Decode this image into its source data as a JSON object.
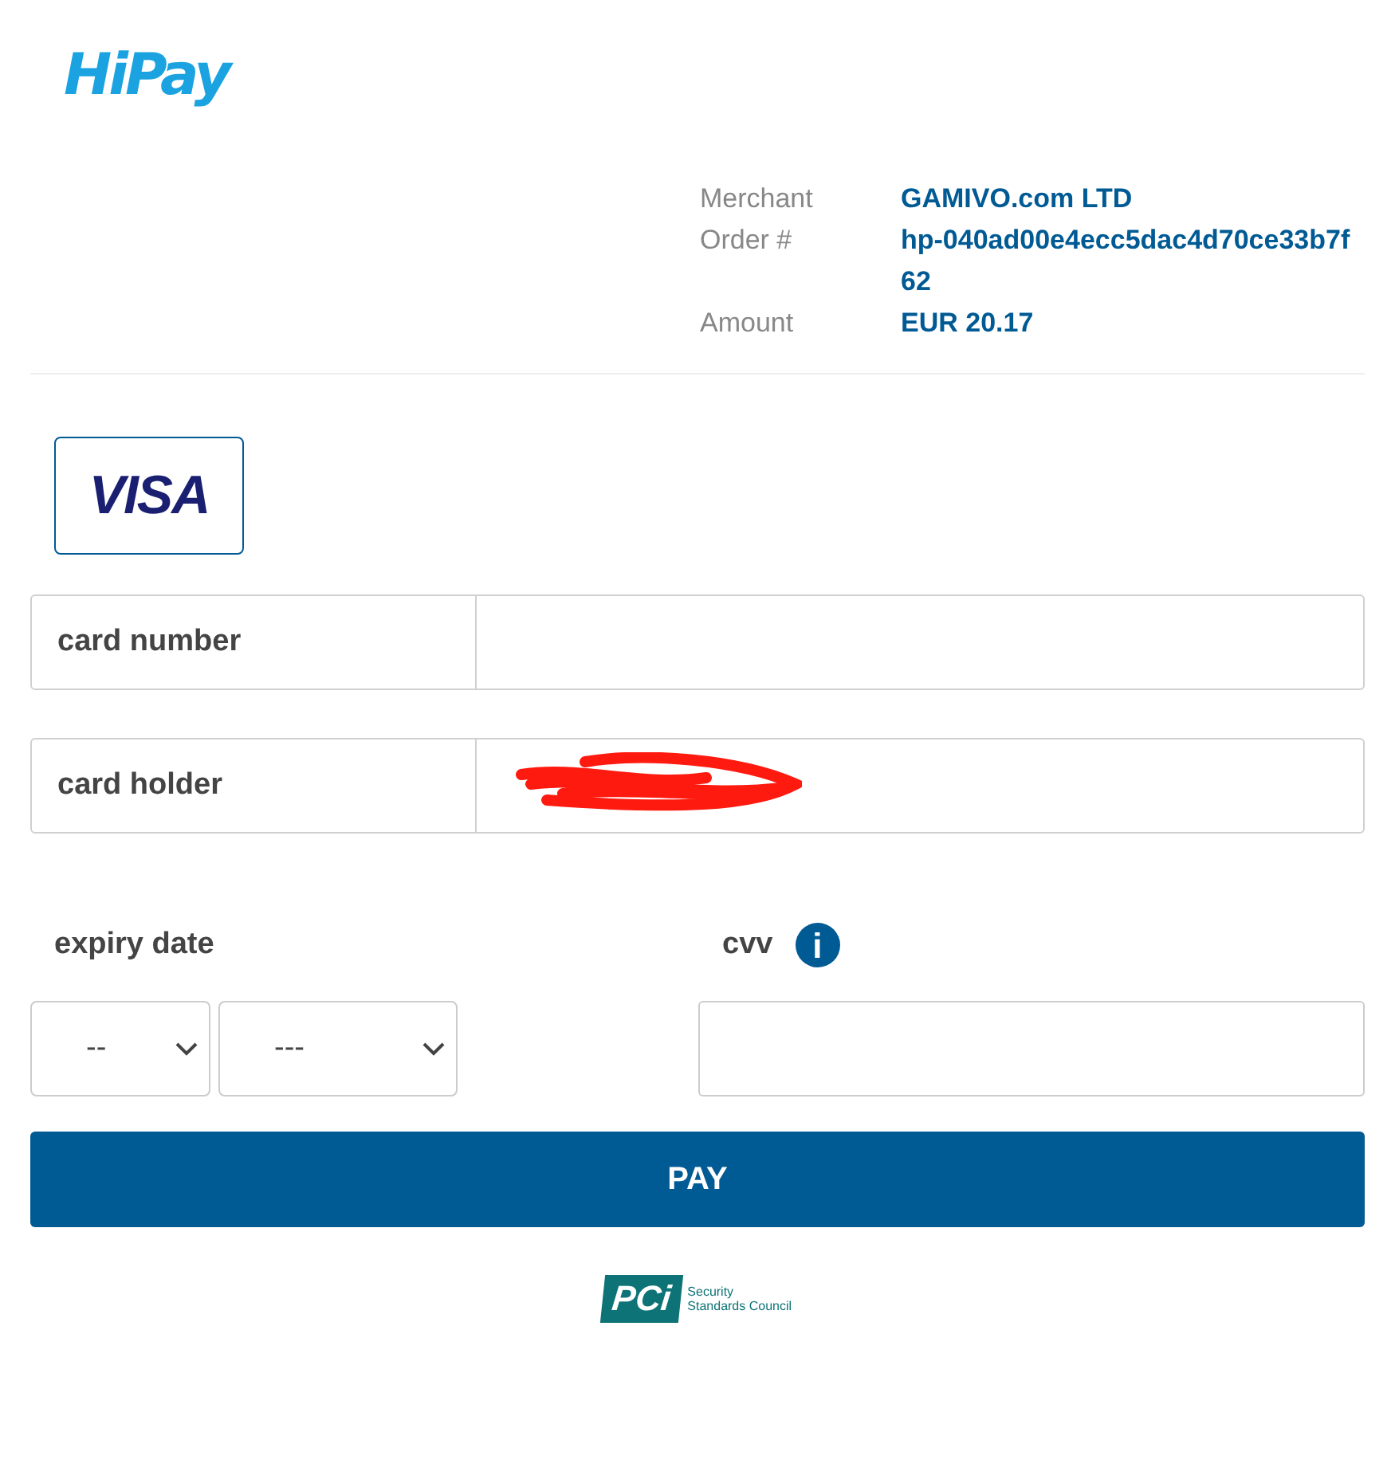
{
  "logo": {
    "text": "HiPay"
  },
  "order_summary": [
    {
      "label": "Merchant",
      "value": "GAMIVO.com LTD"
    },
    {
      "label": "Order #",
      "value": "hp-040ad00e4ecc5dac4d70ce33b7f62"
    },
    {
      "label": "Amount",
      "value": "EUR 20.17"
    }
  ],
  "card_brands": [
    {
      "label": "VISA",
      "selected": true
    }
  ],
  "fields": [
    {
      "label": "card number",
      "redacted": false
    },
    {
      "label": "card holder",
      "redacted": true
    }
  ],
  "expiry": {
    "label": "expiry date",
    "month": "--",
    "year": "---"
  },
  "cvv": {
    "label": "cvv",
    "info_icon": "i"
  },
  "pay_button": "PAY",
  "pci_logo": {
    "mark": "PCi",
    "lines": [
      "Security",
      "Standards Council"
    ]
  }
}
